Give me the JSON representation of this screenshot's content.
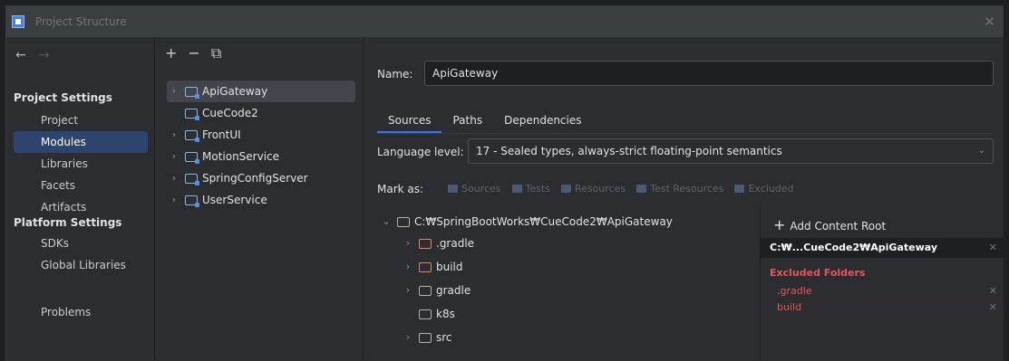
{
  "window": {
    "title": "Project Structure"
  },
  "nav": {
    "project_settings_heading": "Project Settings",
    "platform_settings_heading": "Platform Settings",
    "items": [
      {
        "label": "Project"
      },
      {
        "label": "Modules"
      },
      {
        "label": "Libraries"
      },
      {
        "label": "Facets"
      },
      {
        "label": "Artifacts"
      },
      {
        "label": "SDKs"
      },
      {
        "label": "Global Libraries"
      },
      {
        "label": "Problems"
      }
    ],
    "selected": "Modules"
  },
  "modules": {
    "toolbar": {
      "add": "+",
      "remove": "−",
      "copy": "⧉"
    },
    "items": [
      {
        "label": "ApiGateway",
        "expandable": true
      },
      {
        "label": "CueCode2",
        "expandable": false
      },
      {
        "label": "FrontUI",
        "expandable": true
      },
      {
        "label": "MotionService",
        "expandable": true
      },
      {
        "label": "SpringConfigServer",
        "expandable": true
      },
      {
        "label": "UserService",
        "expandable": true
      }
    ],
    "selected": "ApiGateway"
  },
  "details": {
    "name_label": "Name:",
    "name_value": "ApiGateway",
    "tabs": [
      "Sources",
      "Paths",
      "Dependencies"
    ],
    "active_tab": "Sources",
    "language_level_label": "Language level:",
    "language_level_value": "17 - Sealed types, always-strict floating-point semantics",
    "mark_as_label": "Mark as:",
    "mark_as_buttons": [
      "Sources",
      "Tests",
      "Resources",
      "Test Resources",
      "Excluded"
    ]
  },
  "tree": {
    "root": "C:₩SpringBootWorks₩CueCode2₩ApiGateway",
    "children": [
      {
        "label": ".gradle",
        "excluded": true,
        "expandable": true
      },
      {
        "label": "build",
        "excluded": true,
        "expandable": true
      },
      {
        "label": "gradle",
        "excluded": false,
        "expandable": true
      },
      {
        "label": "k8s",
        "excluded": false,
        "expandable": false
      },
      {
        "label": "src",
        "excluded": false,
        "expandable": true
      }
    ]
  },
  "content_roots": {
    "add_label": "Add Content Root",
    "root_path": "C:₩...CueCode2₩ApiGateway",
    "excluded_heading": "Excluded Folders",
    "excluded": [
      ".gradle",
      "build"
    ]
  },
  "colors": {
    "selection": "#2e436e",
    "excluded": "#e5555c",
    "accent": "#3574f0"
  }
}
